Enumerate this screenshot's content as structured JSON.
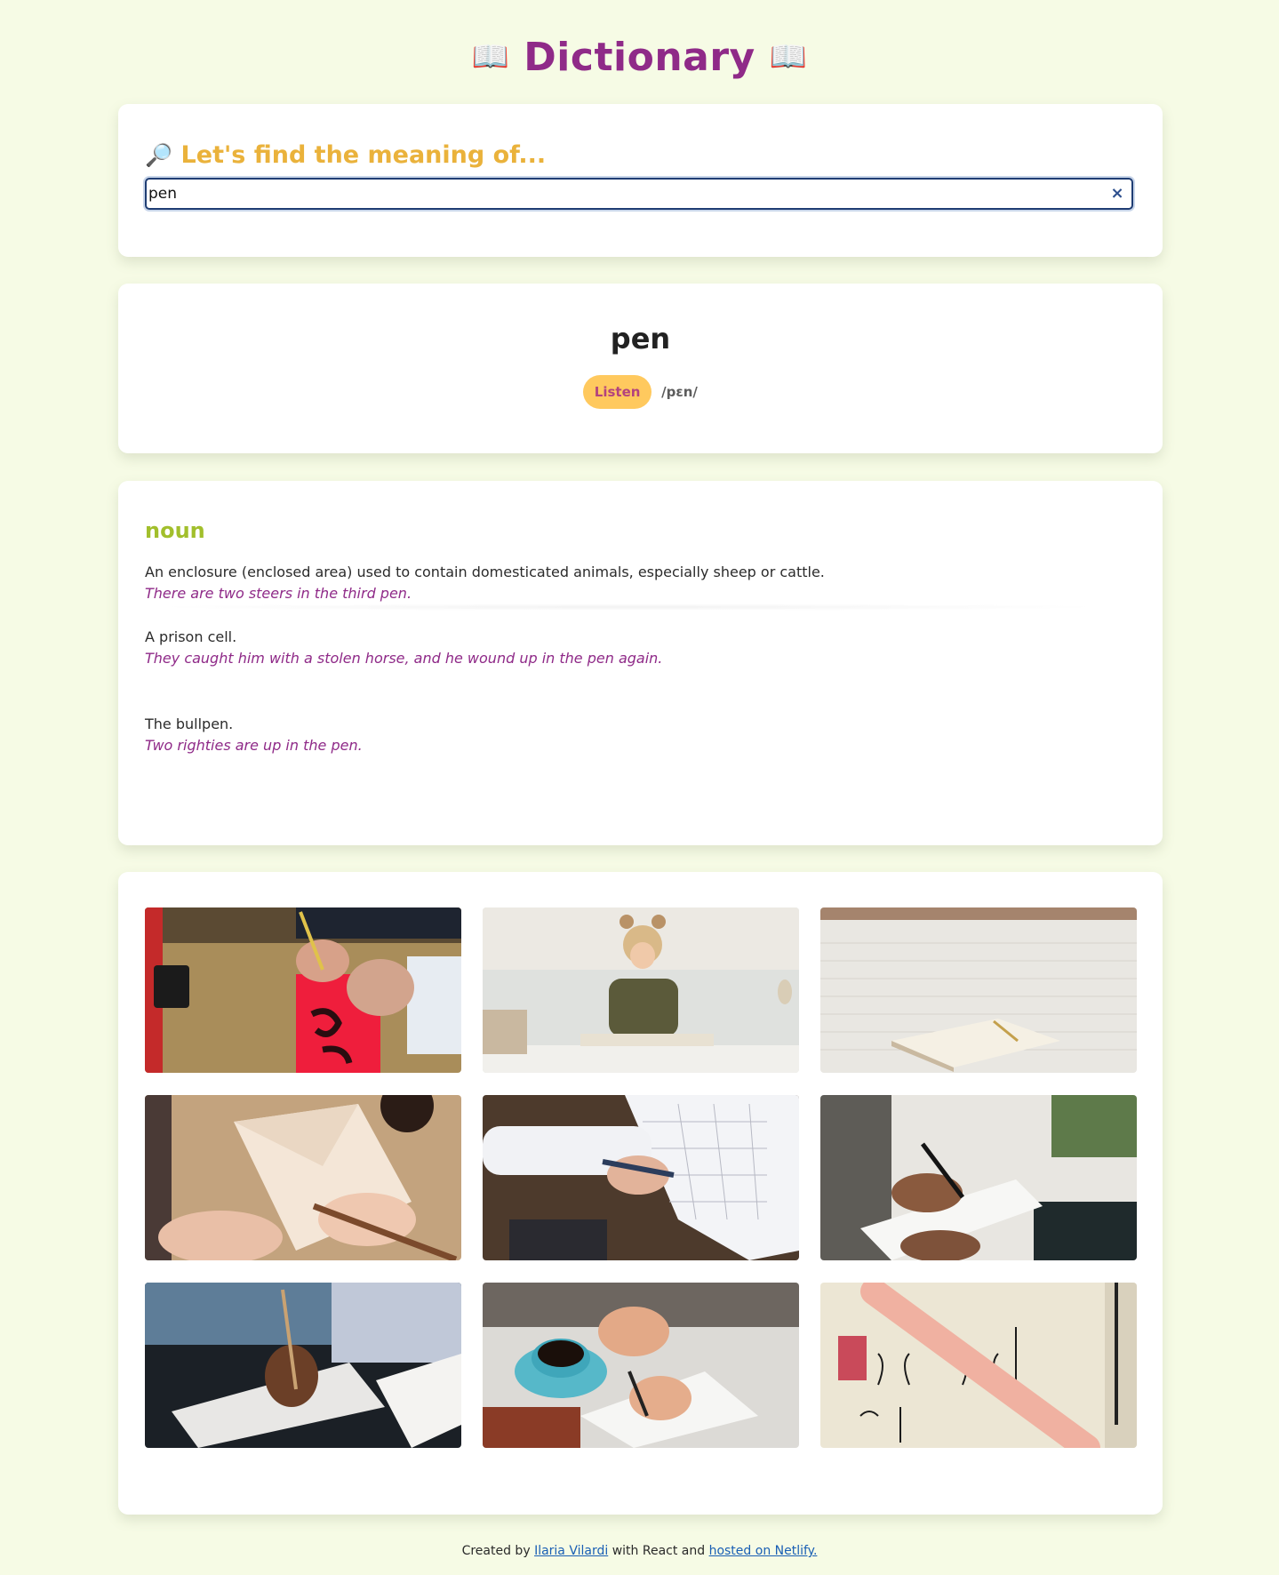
{
  "header": {
    "title": "Dictionary",
    "left_icon": "📖",
    "right_icon": "📖"
  },
  "search": {
    "heading_icon": "🔎",
    "heading": "Let's find the meaning of...",
    "value": "pen",
    "clear_symbol": "×"
  },
  "word": {
    "text": "pen",
    "listen_label": "Listen",
    "phonetic": "/pɛn/"
  },
  "meaning": {
    "part_of_speech": "noun",
    "definitions": [
      {
        "definition": "An enclosure (enclosed area) used to contain domesticated animals, especially sheep or cattle.",
        "example": "There are two steers in the third pen."
      },
      {
        "definition": "A prison cell.",
        "example": "They caught him with a stolen horse, and he wound up in the pen again."
      },
      {
        "definition": "The bullpen.",
        "example": "Two righties are up in the pen."
      }
    ]
  },
  "photos": [
    {
      "subject": "calligraphy-brush-on-red-paper"
    },
    {
      "subject": "girl-writing-at-desk"
    },
    {
      "subject": "notebook-and-pencil-on-bed"
    },
    {
      "subject": "fountain-pen-writing-letter"
    },
    {
      "subject": "holding-pen-and-calendar"
    },
    {
      "subject": "writing-on-clipboard"
    },
    {
      "subject": "hand-writing-in-notebook"
    },
    {
      "subject": "writing-next-to-coffee-cup"
    },
    {
      "subject": "math-notes-and-pencil"
    }
  ],
  "footer": {
    "prefix": "Created by ",
    "author_link": "Ilaria Vilardi",
    "middle": " with React and ",
    "hosting_link": "hosted on Netlify."
  }
}
